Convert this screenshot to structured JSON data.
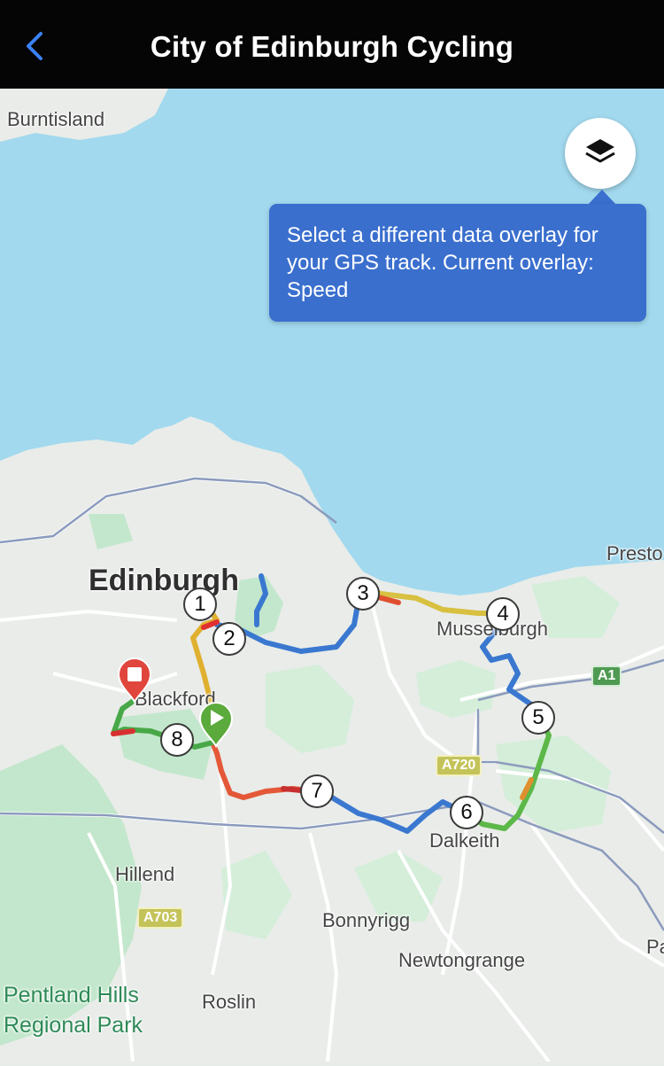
{
  "header": {
    "title": "City of Edinburgh Cycling"
  },
  "tooltip": {
    "text": "Select a different data overlay for your GPS track. Current overlay: Speed"
  },
  "overlay": "Speed",
  "map": {
    "place_labels": {
      "burntisland": "Burntisland",
      "edinburgh": "Edinburgh",
      "preston": "Presto",
      "musselburgh": "Musselburgh",
      "blackford": "Blackford",
      "dalkeith": "Dalkeith",
      "hillend": "Hillend",
      "bonnyrigg": "Bonnyrigg",
      "newtongrange": "Newtongrange",
      "roslin": "Roslin",
      "pa": "Pa",
      "pentland": "Pentland Hills Regional Park"
    },
    "road_badges": {
      "a1": "A1",
      "a720": "A720",
      "a703": "A703"
    },
    "waypoints": [
      "1",
      "2",
      "3",
      "4",
      "5",
      "6",
      "7",
      "8"
    ]
  },
  "colors": {
    "header_bg": "#050505",
    "back_chevron": "#3b82f6",
    "water": "#a2d9ee",
    "land": "#e9ece9",
    "park": "#c3e7cc",
    "tooltip_bg": "#3a6fce",
    "start_marker": "#5aaa3c",
    "end_marker": "#e0463c"
  },
  "icons": {
    "back": "chevron-left-icon",
    "layers": "layers-icon",
    "start": "play-pin-icon",
    "end": "stop-pin-icon"
  }
}
